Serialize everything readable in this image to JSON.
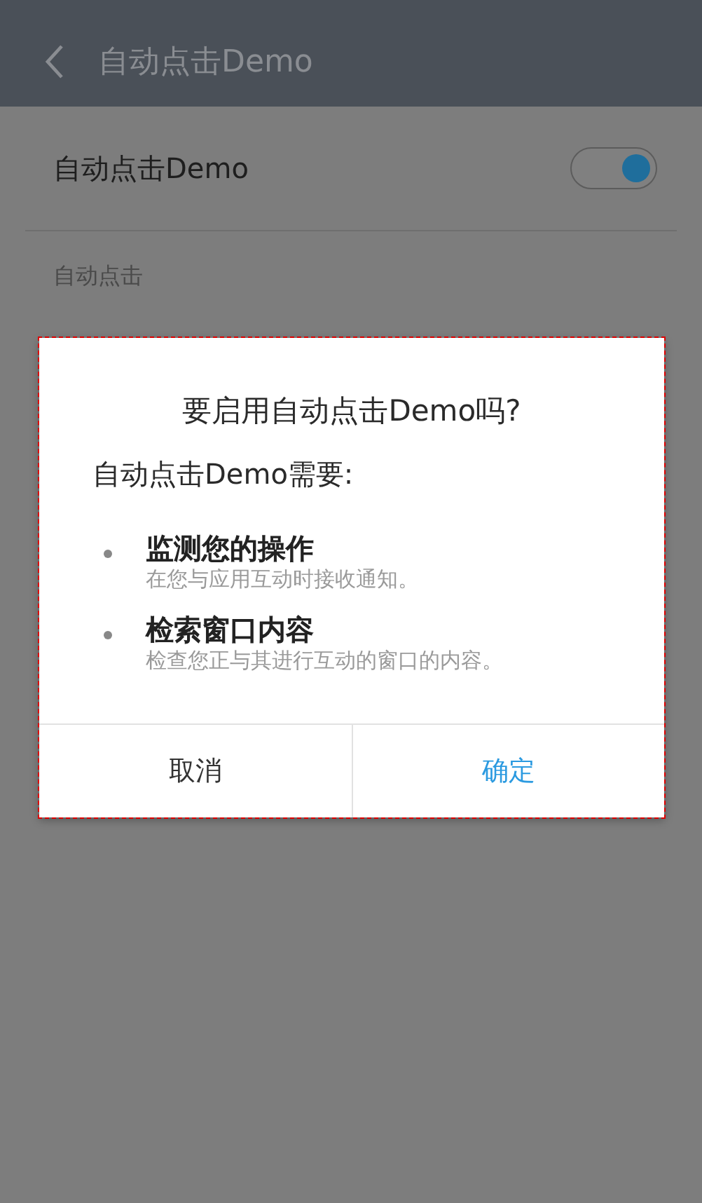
{
  "app_bar": {
    "title": "自动点击Demo"
  },
  "settings": {
    "switch_row": {
      "label": "自动点击Demo",
      "on": true
    },
    "section_header": "自动点击"
  },
  "dialog": {
    "title": "要启用自动点击Demo吗?",
    "intro": "自动点击Demo需要:",
    "permissions": [
      {
        "title": "监测您的操作",
        "description": "在您与应用互动时接收通知。"
      },
      {
        "title": "检索窗口内容",
        "description": "检查您正与其进行互动的窗口的内容。"
      }
    ],
    "buttons": [
      {
        "label": "取消",
        "kind": "neutral"
      },
      {
        "label": "确定",
        "kind": "confirm"
      }
    ]
  }
}
